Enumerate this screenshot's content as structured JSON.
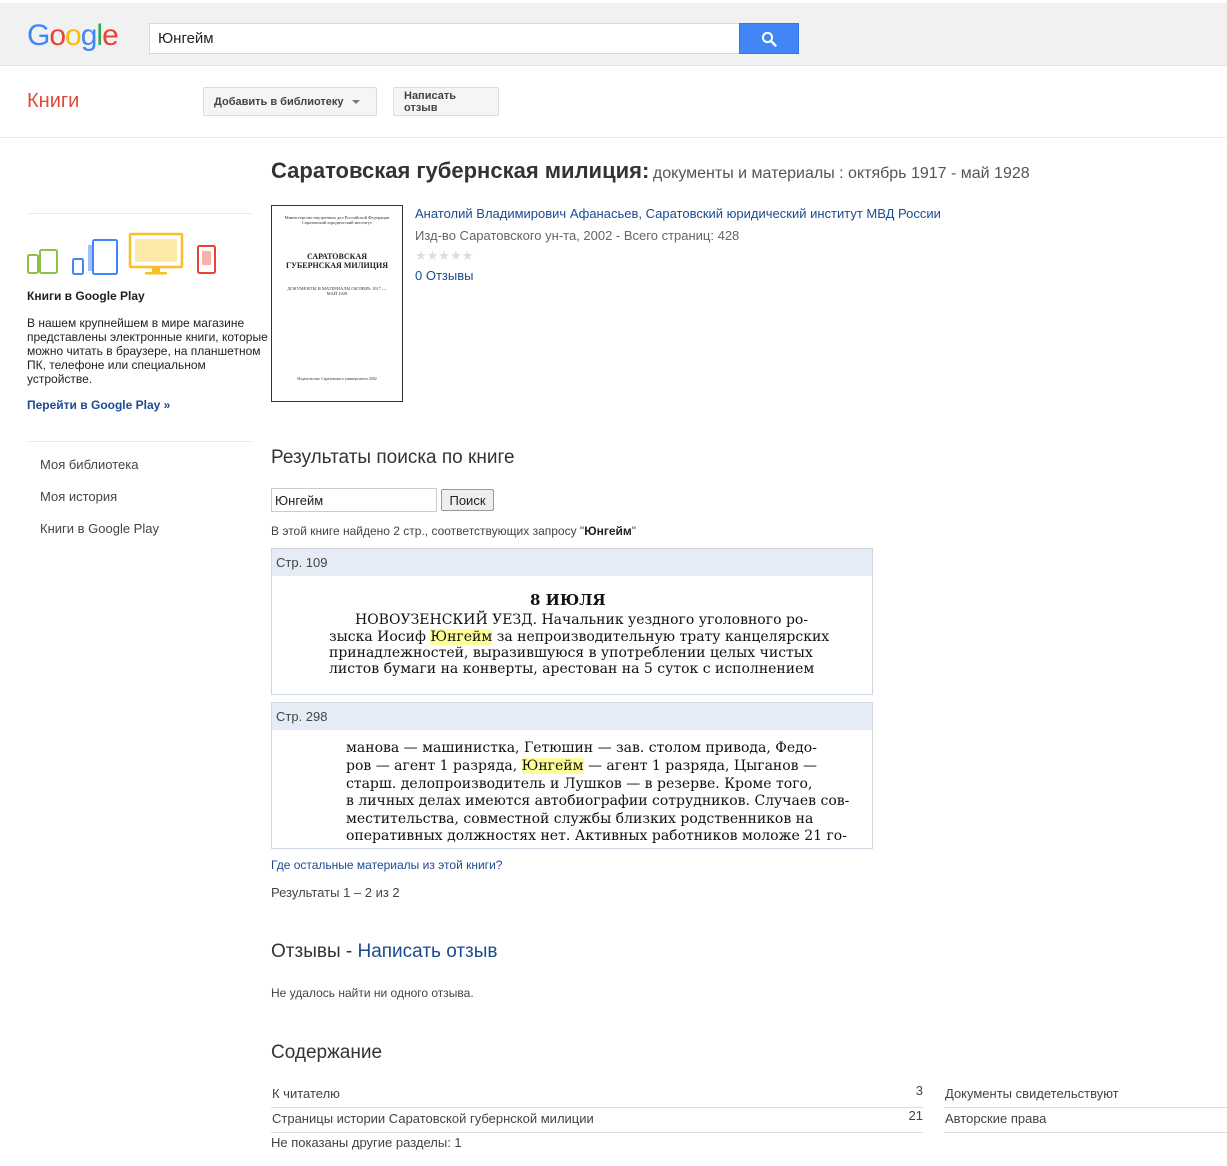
{
  "header": {
    "logo_letters": [
      "G",
      "o",
      "o",
      "g",
      "l",
      "e"
    ],
    "logo_colors": [
      "#4285f4",
      "#ea4335",
      "#fbbc05",
      "#4285f4",
      "#34a853",
      "#ea4335"
    ],
    "search_value": "Юнгейм",
    "search_icon": "search-icon"
  },
  "subbar": {
    "section_title": "Книги",
    "add_to_library": "Добавить в библиотеку",
    "write_review": "Написать отзыв"
  },
  "sidebar": {
    "promo_title": "Книги в Google Play",
    "promo_text": "В нашем крупнейшем в мире магазине представлены электронные книги, которые можно читать в браузере, на планшетном ПК, телефоне или специальном устройстве.",
    "promo_link": "Перейти в Google Play »",
    "nav": [
      "Моя библиотека",
      "Моя история",
      "Книги в Google Play"
    ]
  },
  "book": {
    "title_main": "Саратовская губернская милиция:",
    "title_sub": "документы и материалы : октябрь 1917 - май 1928",
    "author1": "Анатолий Владимирович Афанасьев",
    "author2": "Саратовский юридический институт МВД России",
    "author_sep": ", ",
    "pubinfo": "Изд-во Саратовского ун-та, 2002 - Всего страниц: 428",
    "rating_stars": "★★★★★",
    "rating": 0,
    "reviews_link": "0 Отзывы",
    "cover": {
      "publisher": "Министерство внутренних дел Российской Федерации Саратовский юридический институт",
      "title": "САРАТОВСКАЯ ГУБЕРНСКАЯ МИЛИЦИЯ",
      "subtitle": "ДОКУМЕНТЫ И МАТЕРИАЛЫ ОКТЯБРЬ 1917 — МАЙ 1928",
      "bottom": "Издательство Саратовского университета 2002"
    }
  },
  "search_in_book": {
    "heading": "Результаты поиска по книге",
    "input_value": "Юнгейм",
    "button": "Поиск",
    "found_prefix": "В этой книге найдено 2 стр., соответствующих запросу \"",
    "found_query": "Юнгейм",
    "found_suffix": "\"",
    "results": [
      {
        "page": "Стр. 109",
        "lines": [
          {
            "pre": "8 ИЮЛЯ",
            "hl": "",
            "post": ""
          },
          {
            "pre": "НОВОУЗЕНСКИЙ УЕЗД. Начальник уездного уголовного ро-",
            "hl": "",
            "post": ""
          },
          {
            "pre": "зыска Иосиф ",
            "hl": "Юнгейм",
            "post": " за непроизводительную трату канцелярских"
          },
          {
            "pre": "принадлежностей, выразившуюся в употреблении целых чистых",
            "hl": "",
            "post": ""
          },
          {
            "pre": "листов бумаги на конверты, арестован на 5 суток с исполнением",
            "hl": "",
            "post": ""
          }
        ]
      },
      {
        "page": "Стр. 298",
        "lines": [
          {
            "pre": "манова — машинистка, Гетюшин — зав. столом привода, Федо-",
            "hl": "",
            "post": ""
          },
          {
            "pre": "ров — агент 1 разряда, ",
            "hl": "Юнгейм",
            "post": " — агент 1 разряда, Цыганов —"
          },
          {
            "pre": "старш. делопроизводитель и Лушков — в резерве. Кроме того,",
            "hl": "",
            "post": ""
          },
          {
            "pre": "в личных делах имеются автобиографии сотрудников. Случаев сов-",
            "hl": "",
            "post": ""
          },
          {
            "pre": "местительства, совместной службы близких родственников на",
            "hl": "",
            "post": ""
          },
          {
            "pre": "оперативных должностях нет. Активных работников моложе 21 го-",
            "hl": "",
            "post": ""
          }
        ]
      }
    ],
    "more_link": "Где остальные материалы из этой книги?",
    "range": "Результаты 1 – 2 из 2"
  },
  "reviews": {
    "heading": "Отзывы - ",
    "write_link": "Написать отзыв",
    "none_text": "Не удалось найти ни одного отзыва."
  },
  "toc": {
    "heading": "Содержание",
    "left": [
      {
        "title": "К читателю",
        "page": "3"
      },
      {
        "title": "Страницы истории Саратовской губернской милиции",
        "page": "21"
      }
    ],
    "right": [
      {
        "title": "Документы свидетельствуют",
        "page": ""
      },
      {
        "title": "Авторские права",
        "page": ""
      }
    ],
    "hidden_note": "Не показаны другие разделы: 1"
  }
}
